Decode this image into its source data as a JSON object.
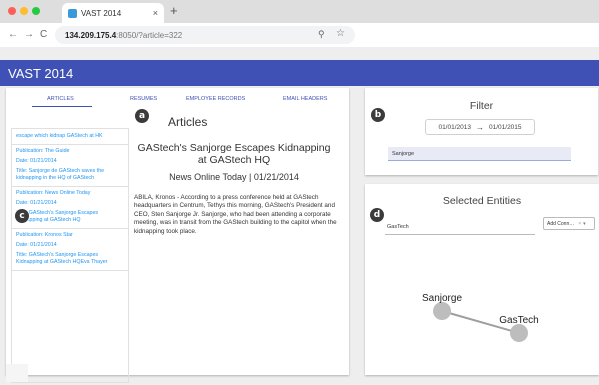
{
  "browser": {
    "tab_title": "VAST 2014",
    "tab_close": "×",
    "new_tab": "+",
    "url_host": "134.209.175.4",
    "url_path": ":8050/?article=322",
    "back": "←",
    "forward": "→",
    "reload": "C",
    "zoom": "⚲",
    "star": "☆"
  },
  "app": {
    "title": "VAST 2014"
  },
  "tabs": [
    "ARTICLES",
    "RESUMES",
    "EMPLOYEE RECORDS",
    "EMAIL HEADERS"
  ],
  "articles_list": {
    "partial": "escape which kidnap GAStech at HK",
    "items": [
      {
        "publication": "Publication: The Guide",
        "date": "Date: 01/21/2014",
        "title": "Title: Sanjorge de GAStech saves the kidnapping in the HQ of GAStech"
      },
      {
        "publication": "Publication: News Online Today",
        "date": "Date: 01/21/2014",
        "title": "Title: GAStech's Sanjorge Escapes Kidnapping at GAStech HQ"
      },
      {
        "publication": "Publication: Kronos Star",
        "date": "Date: 01/21/2014",
        "title": "Title: GAStech's Sanjorge Escapes Kidnapping at GAStech HQEva Thayer"
      }
    ]
  },
  "article": {
    "heading": "Articles",
    "title": "GAStech's Sanjorge Escapes Kidnapping at GAStech HQ",
    "source": "News Online Today | 01/21/2014",
    "body": "ABILA, Kronos - According to a press conference held at GAStech headquarters in Centrum, Tethys this morning, GAStech's President and CEO, Sten Sanjorge Jr. Sanjorge, who had been attending a corporate meeting, was in transit from the GAStech building to the capitol when the kidnapping took place."
  },
  "filter": {
    "title": "Filter",
    "start_date": "01/01/2013",
    "arrow": "→",
    "end_date": "01/01/2015",
    "query": "Sanjorge"
  },
  "entities": {
    "title": "Selected Entities",
    "input_value": "GasTech",
    "button_label": "Add Conn…",
    "button_clear": "×",
    "button_caret": "▾",
    "nodes": [
      "Sanjorge",
      "GasTech"
    ]
  },
  "markers": [
    "a",
    "b",
    "c",
    "d"
  ],
  "colors": {
    "app_bar": "#3f51b5",
    "link": "#2196f3",
    "node": "#bdbdbd",
    "edge": "#9e9e9e",
    "marker": "#3b3b3b"
  }
}
